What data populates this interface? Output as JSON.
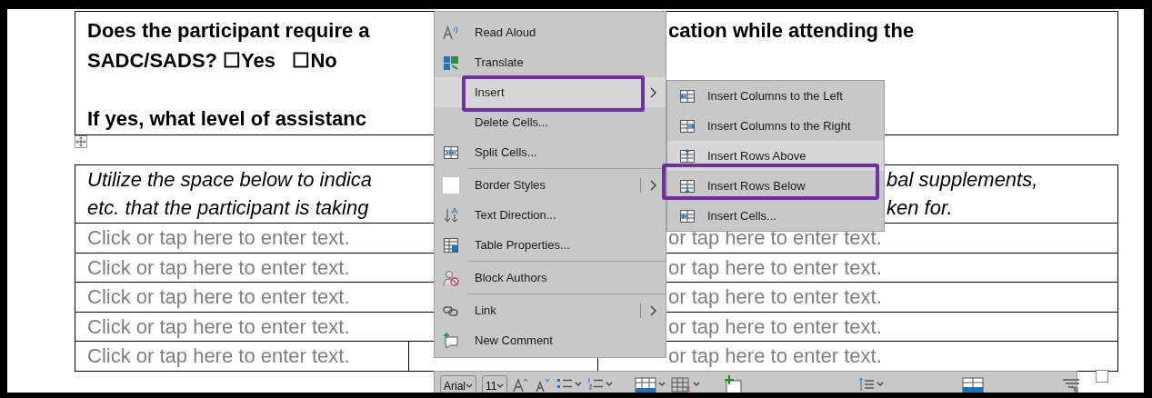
{
  "document": {
    "question_table": {
      "paragraphs": [
        {
          "lines": [
            {
              "left": "Does the participant require a",
              "right": "cation while attending the"
            },
            {
              "left": "SADC/SADS? ☐Yes   ☐No"
            }
          ]
        },
        {
          "lines": [
            {
              "left": "If yes, what level of assistanc"
            }
          ]
        }
      ]
    },
    "medication_table": {
      "instructions": [
        {
          "left": "Utilize the space below to indica",
          "right": "bal supplements,"
        },
        {
          "left": "etc. that the participant is taking",
          "right": "ken for."
        }
      ],
      "rows": [
        {
          "kind": "plain",
          "column_1": "Click or tap here to enter text.",
          "column_2": "or tap here to enter text."
        },
        {
          "kind": "plain",
          "column_1": "Click or tap here to enter text.",
          "column_2": "or tap here to enter text."
        },
        {
          "kind": "plain",
          "column_1": "Click or tap here to enter text.",
          "column_2": "or tap here to enter text."
        },
        {
          "kind": "plain",
          "column_1": "Click or tap here to enter text.",
          "column_2": "or tap here to enter text."
        },
        {
          "kind": "split",
          "column_1": "Click or tap here to enter text.",
          "column_2": "or tap here to enter text."
        }
      ]
    }
  },
  "context_menu": {
    "groups": [
      {
        "items": [
          {
            "label": "Read Aloud",
            "selected": false,
            "annotated": false,
            "kind": "plain"
          },
          {
            "label": "Translate",
            "selected": false,
            "annotated": false,
            "kind": "plain"
          },
          {
            "label": "Insert",
            "selected": true,
            "annotated": true,
            "kind": "submenu"
          },
          {
            "label": "Delete Cells...",
            "selected": false,
            "annotated": false,
            "kind": "plain"
          },
          {
            "label": "Split Cells...",
            "selected": false,
            "annotated": false,
            "kind": "plain"
          }
        ]
      },
      {
        "items": [
          {
            "label": "Border Styles",
            "selected": false,
            "annotated": false,
            "kind": "split"
          },
          {
            "label": "Text Direction...",
            "selected": false,
            "annotated": false,
            "kind": "plain"
          },
          {
            "label": "Table Properties...",
            "selected": false,
            "annotated": false,
            "kind": "plain"
          }
        ]
      },
      {
        "items": [
          {
            "label": "Block Authors",
            "selected": false,
            "annotated": false,
            "kind": "plain"
          }
        ]
      },
      {
        "items": [
          {
            "label": "Link",
            "selected": false,
            "annotated": false,
            "kind": "split"
          },
          {
            "label": "New Comment",
            "selected": false,
            "annotated": false,
            "kind": "plain"
          }
        ]
      }
    ]
  },
  "insert_submenu": {
    "items": [
      {
        "label": "Insert Columns to the Left",
        "selected": false,
        "annotated": false
      },
      {
        "label": "Insert Columns to the Right",
        "selected": false,
        "annotated": false
      },
      {
        "label": "Insert Rows Above",
        "selected": true,
        "annotated": false
      },
      {
        "label": "Insert Rows Below",
        "selected": false,
        "annotated": true
      },
      {
        "label": "Insert Cells...",
        "selected": false,
        "annotated": false
      }
    ]
  },
  "mini_toolbar": {
    "font": "Arial",
    "size": "11"
  }
}
